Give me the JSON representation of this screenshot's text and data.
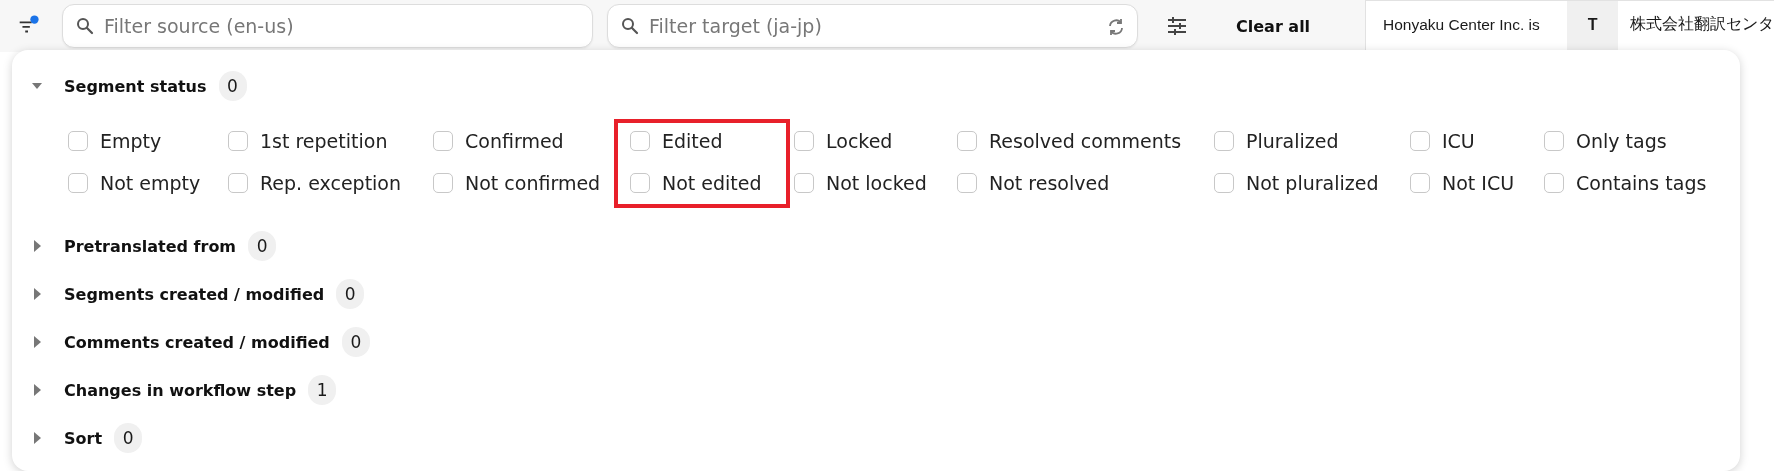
{
  "toolbar": {
    "filter_active": true,
    "source_search": {
      "placeholder": "Filter source (en-us)"
    },
    "target_search": {
      "placeholder": "Filter target (ja-jp)"
    },
    "clear_button": "Clear all"
  },
  "segment_row": {
    "source": "Honyaku Center Inc. is",
    "type_badge": "T",
    "target": "株式会社翻訳センタ"
  },
  "filter_panel": {
    "sections": [
      {
        "title": "Segment status",
        "count": "0",
        "expanded": true,
        "option_columns": [
          {
            "highlighted": false,
            "options": [
              {
                "label": "Empty",
                "checked": false
              },
              {
                "label": "Not empty",
                "checked": false
              }
            ]
          },
          {
            "highlighted": false,
            "options": [
              {
                "label": "1st repetition",
                "checked": false
              },
              {
                "label": "Rep. exception",
                "checked": false
              }
            ]
          },
          {
            "highlighted": false,
            "options": [
              {
                "label": "Confirmed",
                "checked": false
              },
              {
                "label": "Not confirmed",
                "checked": false
              }
            ]
          },
          {
            "highlighted": true,
            "options": [
              {
                "label": "Edited",
                "checked": false
              },
              {
                "label": "Not edited",
                "checked": false
              }
            ]
          },
          {
            "highlighted": false,
            "options": [
              {
                "label": "Locked",
                "checked": false
              },
              {
                "label": "Not locked",
                "checked": false
              }
            ]
          },
          {
            "highlighted": false,
            "options": [
              {
                "label": "Resolved comments",
                "checked": false
              },
              {
                "label": "Not resolved",
                "checked": false
              }
            ]
          },
          {
            "highlighted": false,
            "options": [
              {
                "label": "Pluralized",
                "checked": false
              },
              {
                "label": "Not pluralized",
                "checked": false
              }
            ]
          },
          {
            "highlighted": false,
            "options": [
              {
                "label": "ICU",
                "checked": false
              },
              {
                "label": "Not ICU",
                "checked": false
              }
            ]
          },
          {
            "highlighted": false,
            "options": [
              {
                "label": "Only tags",
                "checked": false
              },
              {
                "label": "Contains tags",
                "checked": false
              }
            ]
          }
        ]
      },
      {
        "title": "Pretranslated from",
        "count": "0",
        "expanded": false
      },
      {
        "title": "Segments created / modified",
        "count": "0",
        "expanded": false
      },
      {
        "title": "Comments created / modified",
        "count": "0",
        "expanded": false
      },
      {
        "title": "Changes in workflow step",
        "count": "1",
        "expanded": false
      },
      {
        "title": "Sort",
        "count": "0",
        "expanded": false
      }
    ]
  }
}
